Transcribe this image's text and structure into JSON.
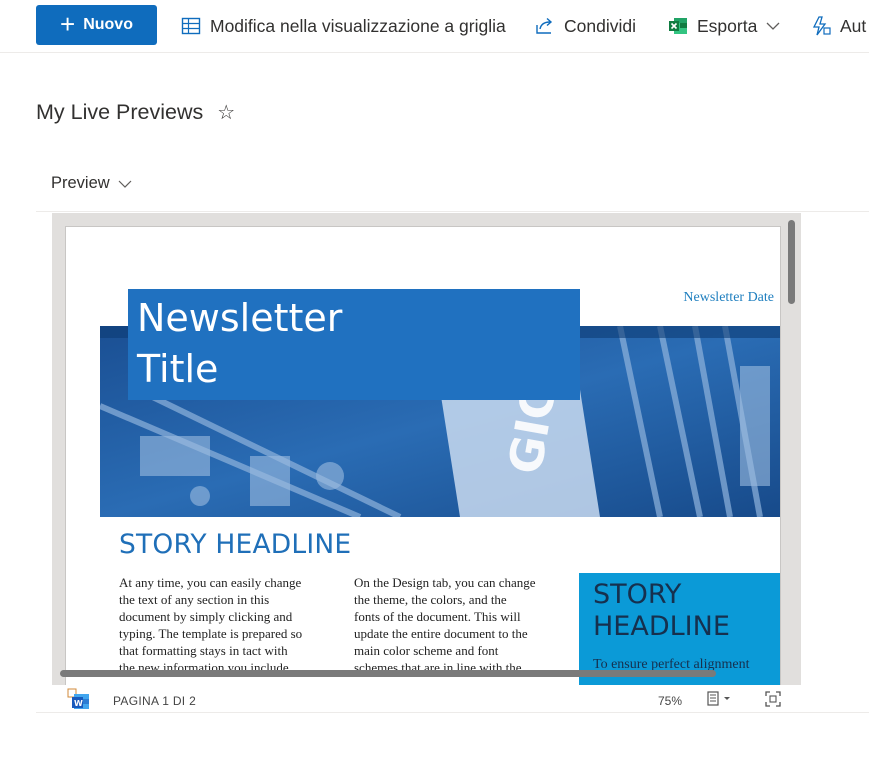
{
  "commandbar": {
    "new_label": "Nuovo",
    "grid_edit_label": "Modifica nella visualizzazione a griglia",
    "share_label": "Condividi",
    "export_label": "Esporta",
    "automate_label": "Aut"
  },
  "list": {
    "title": "My Live Previews",
    "column_header": "Preview"
  },
  "document": {
    "newsletter_title_line1": "Newsletter",
    "newsletter_title_line2": "Title",
    "newsletter_date": "Newsletter Date",
    "story_headline": "STORY HEADLINE",
    "column1": [
      "At any time, you can easily change",
      "the text of any section in this",
      "document by simply clicking and",
      "typing.  The template is prepared so",
      "that formatting stays in tact with",
      "the new information you include."
    ],
    "column2": [
      "On the Design tab, you can change",
      "the theme, the colors, and the",
      "fonts of the document.  This will",
      "update the entire document to the",
      "main color scheme and font",
      "schemes that are in line with the"
    ],
    "sidebar_headline_line1": "STORY",
    "sidebar_headline_line2": "HEADLINE",
    "sidebar_text": "To ensure perfect alignment"
  },
  "statusbar": {
    "page_indicator": "PAGINA 1 DI 2",
    "zoom": "75%"
  },
  "colors": {
    "accent": "#0f6cbd",
    "newsletter_blue": "#2071c0",
    "sidebar_blue": "#0b9ad7",
    "excel_green": "#107c41"
  }
}
